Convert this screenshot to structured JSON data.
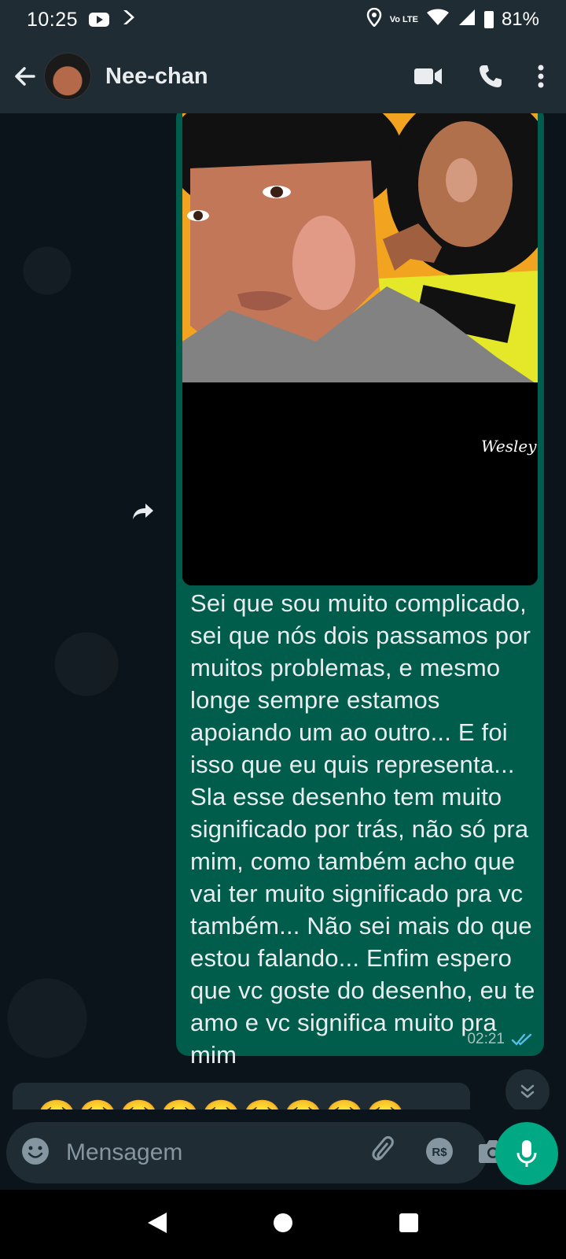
{
  "status_bar": {
    "time": "10:25",
    "volte": "Vo LTE",
    "battery": "81%"
  },
  "header": {
    "contact_name": "Nee-chan"
  },
  "message_out": {
    "image_signature": "Wesley",
    "text": "Sei que sou muito complicado, sei que nós dois passamos por muitos problemas, e mesmo longe sempre estamos apoiando um ao outro... E foi isso que eu quis representa... Sla esse desenho tem muito significado por trás, não só pra mim, como também acho que vai ter muito significado pra vc também... Não sei mais do que estou falando... Enfim espero que vc goste do desenho, eu te amo e vc significa muito pra mim",
    "time": "02:21",
    "status": "read"
  },
  "message_in": {
    "emojis": "🥺🥺🥺🥺🥺🥺🥺🥺🥺"
  },
  "input": {
    "placeholder": "Mensagem",
    "value": ""
  },
  "colors": {
    "header_bg": "#1f2c34",
    "chat_bg": "#0b141a",
    "outgoing_bubble": "#005c4b",
    "incoming_bubble": "#1f2c34",
    "accent": "#00a884",
    "read_ticks": "#53bdeb"
  }
}
